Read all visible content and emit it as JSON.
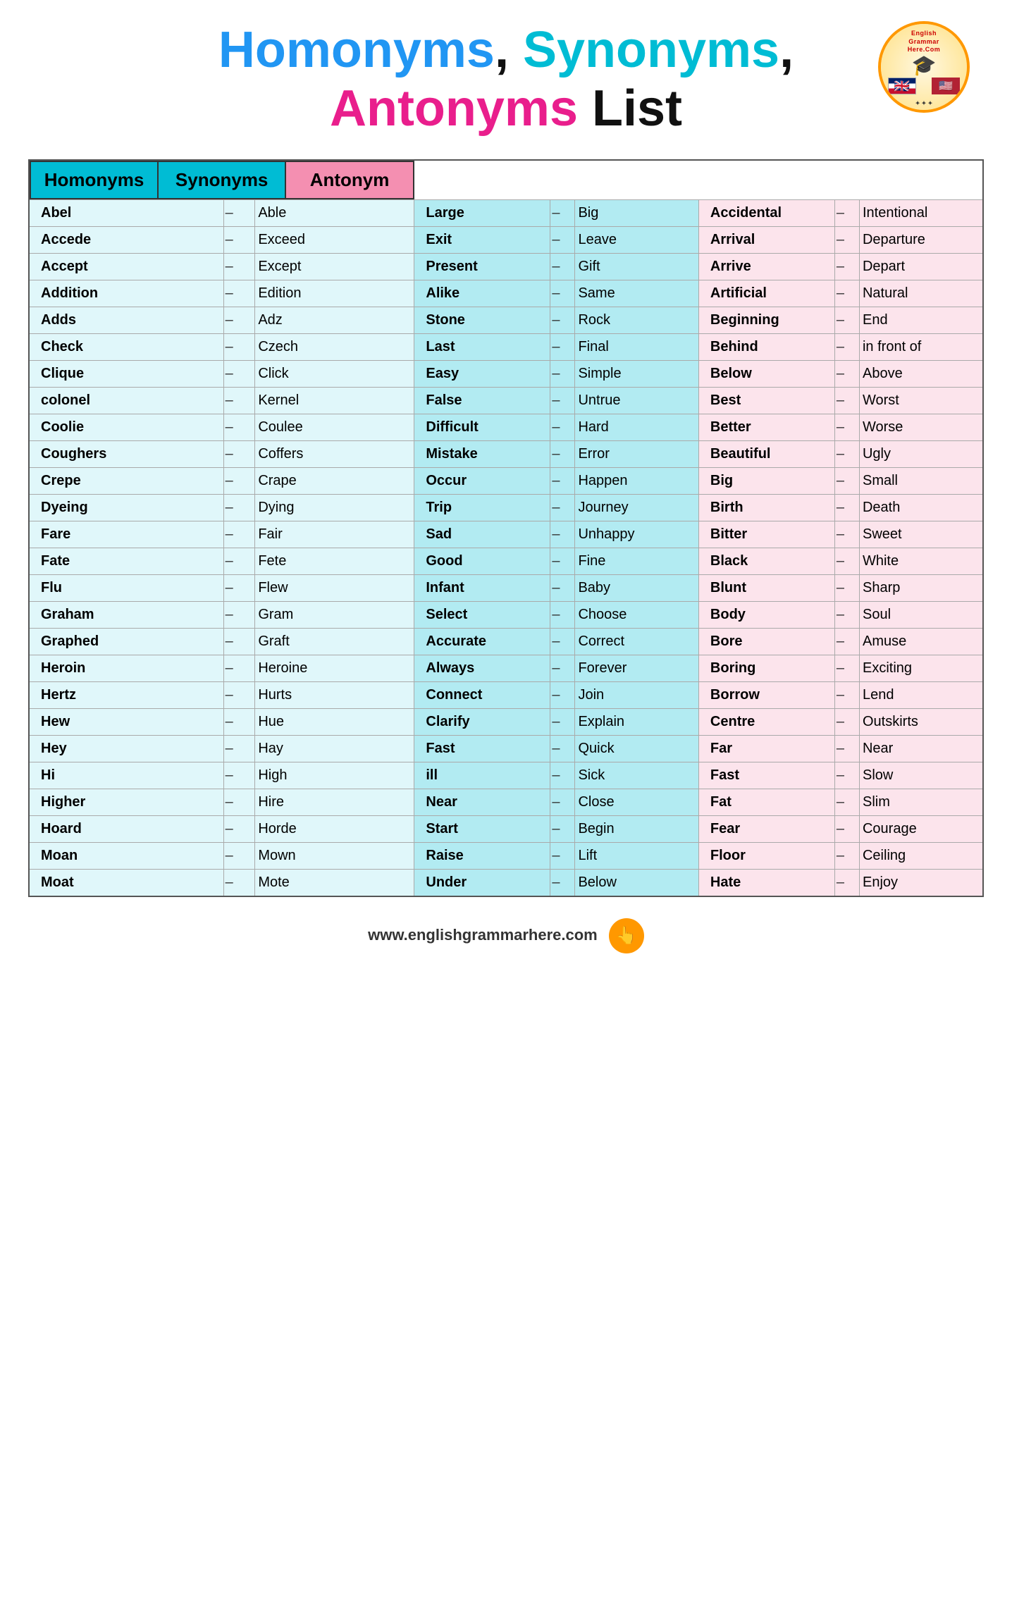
{
  "header": {
    "line1": "Homonyms, Synonyms,",
    "line2_pink": "Antonyms",
    "line2_black": " List"
  },
  "logo": {
    "text": "English\nGrammar\nHere.Com"
  },
  "columns": {
    "homonyms_header": "Homonyms",
    "synonyms_header": "Synonyms",
    "antonyms_header": "Antonym"
  },
  "homonyms": [
    {
      "word": "Abel",
      "dash": "–",
      "value": "Able"
    },
    {
      "word": "Accede",
      "dash": "–",
      "value": "Exceed"
    },
    {
      "word": "Accept",
      "dash": "–",
      "value": "Except"
    },
    {
      "word": "Addition",
      "dash": "–",
      "value": "Edition"
    },
    {
      "word": "Adds",
      "dash": "–",
      "value": "Adz"
    },
    {
      "word": "Check",
      "dash": "–",
      "value": "Czech"
    },
    {
      "word": "Clique",
      "dash": "–",
      "value": "Click"
    },
    {
      "word": "colonel",
      "dash": "–",
      "value": "Kernel"
    },
    {
      "word": "Coolie",
      "dash": "–",
      "value": "Coulee"
    },
    {
      "word": "Coughers",
      "dash": "–",
      "value": "Coffers"
    },
    {
      "word": "Crepe",
      "dash": "–",
      "value": "Crape"
    },
    {
      "word": "Dyeing",
      "dash": "–",
      "value": "Dying"
    },
    {
      "word": "Fare",
      "dash": "–",
      "value": "Fair"
    },
    {
      "word": "Fate",
      "dash": "–",
      "value": "Fete"
    },
    {
      "word": "Flu",
      "dash": "–",
      "value": "Flew"
    },
    {
      "word": "Graham",
      "dash": "–",
      "value": "Gram"
    },
    {
      "word": "Graphed",
      "dash": "–",
      "value": "Graft"
    },
    {
      "word": "Heroin",
      "dash": "–",
      "value": "Heroine"
    },
    {
      "word": "Hertz",
      "dash": "–",
      "value": "Hurts"
    },
    {
      "word": "Hew",
      "dash": "–",
      "value": "Hue"
    },
    {
      "word": "Hey",
      "dash": "–",
      "value": "Hay"
    },
    {
      "word": "Hi",
      "dash": "–",
      "value": "High"
    },
    {
      "word": "Higher",
      "dash": "–",
      "value": "Hire"
    },
    {
      "word": "Hoard",
      "dash": "–",
      "value": "Horde"
    },
    {
      "word": "Moan",
      "dash": "–",
      "value": "Mown"
    },
    {
      "word": "Moat",
      "dash": "–",
      "value": "Mote"
    }
  ],
  "synonyms": [
    {
      "word": "Large",
      "dash": "–",
      "value": "Big"
    },
    {
      "word": "Exit",
      "dash": "–",
      "value": "Leave"
    },
    {
      "word": "Present",
      "dash": "–",
      "value": "Gift"
    },
    {
      "word": "Alike",
      "dash": "–",
      "value": "Same"
    },
    {
      "word": "Stone",
      "dash": "–",
      "value": "Rock"
    },
    {
      "word": "Last",
      "dash": "–",
      "value": "Final"
    },
    {
      "word": "Easy",
      "dash": "–",
      "value": "Simple"
    },
    {
      "word": "False",
      "dash": "–",
      "value": "Untrue"
    },
    {
      "word": "Difficult",
      "dash": "–",
      "value": "Hard"
    },
    {
      "word": "Mistake",
      "dash": "–",
      "value": "Error"
    },
    {
      "word": "Occur",
      "dash": "–",
      "value": "Happen"
    },
    {
      "word": "Trip",
      "dash": "–",
      "value": "Journey"
    },
    {
      "word": "Sad",
      "dash": "–",
      "value": "Unhappy"
    },
    {
      "word": "Good",
      "dash": "–",
      "value": "Fine"
    },
    {
      "word": "Infant",
      "dash": "–",
      "value": "Baby"
    },
    {
      "word": "Select",
      "dash": "–",
      "value": "Choose"
    },
    {
      "word": "Accurate",
      "dash": "–",
      "value": "Correct"
    },
    {
      "word": "Always",
      "dash": "–",
      "value": "Forever"
    },
    {
      "word": "Connect",
      "dash": "–",
      "value": "Join"
    },
    {
      "word": "Clarify",
      "dash": "–",
      "value": "Explain"
    },
    {
      "word": "Fast",
      "dash": "–",
      "value": "Quick"
    },
    {
      "word": "ill",
      "dash": "–",
      "value": "Sick"
    },
    {
      "word": "Near",
      "dash": "–",
      "value": "Close"
    },
    {
      "word": "Start",
      "dash": "–",
      "value": "Begin"
    },
    {
      "word": "Raise",
      "dash": "–",
      "value": "Lift"
    },
    {
      "word": "Under",
      "dash": "–",
      "value": "Below"
    }
  ],
  "antonyms": [
    {
      "word": "Accidental",
      "dash": "–",
      "value": "Intentional"
    },
    {
      "word": "Arrival",
      "dash": "–",
      "value": "Departure"
    },
    {
      "word": "Arrive",
      "dash": "–",
      "value": "Depart"
    },
    {
      "word": "Artificial",
      "dash": "–",
      "value": "Natural"
    },
    {
      "word": "Beginning",
      "dash": "–",
      "value": "End"
    },
    {
      "word": "Behind",
      "dash": "–",
      "value": "in front of"
    },
    {
      "word": "Below",
      "dash": "–",
      "value": "Above"
    },
    {
      "word": "Best",
      "dash": "–",
      "value": "Worst"
    },
    {
      "word": "Better",
      "dash": "–",
      "value": "Worse"
    },
    {
      "word": "Beautiful",
      "dash": "–",
      "value": "Ugly"
    },
    {
      "word": "Big",
      "dash": "–",
      "value": "Small"
    },
    {
      "word": "Birth",
      "dash": "–",
      "value": "Death"
    },
    {
      "word": "Bitter",
      "dash": "–",
      "value": "Sweet"
    },
    {
      "word": "Black",
      "dash": "–",
      "value": "White"
    },
    {
      "word": "Blunt",
      "dash": "–",
      "value": "Sharp"
    },
    {
      "word": "Body",
      "dash": "–",
      "value": "Soul"
    },
    {
      "word": "Bore",
      "dash": "–",
      "value": "Amuse"
    },
    {
      "word": "Boring",
      "dash": "–",
      "value": "Exciting"
    },
    {
      "word": "Borrow",
      "dash": "–",
      "value": "Lend"
    },
    {
      "word": "Centre",
      "dash": "–",
      "value": "Outskirts"
    },
    {
      "word": "Far",
      "dash": "–",
      "value": "Near"
    },
    {
      "word": "Fast",
      "dash": "–",
      "value": "Slow"
    },
    {
      "word": "Fat",
      "dash": "–",
      "value": "Slim"
    },
    {
      "word": "Fear",
      "dash": "–",
      "value": "Courage"
    },
    {
      "word": "Floor",
      "dash": "–",
      "value": "Ceiling"
    },
    {
      "word": "Hate",
      "dash": "–",
      "value": "Enjoy"
    }
  ],
  "footer": {
    "url": "www.englishgrammarhere.com"
  }
}
